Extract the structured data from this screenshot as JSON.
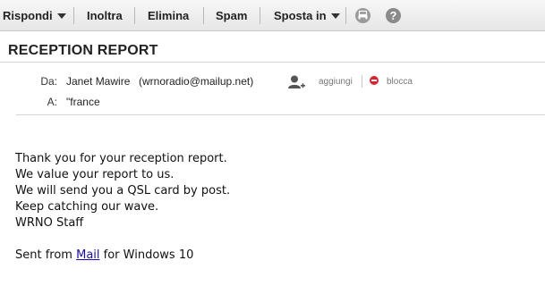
{
  "toolbar": {
    "reply_label": "Rispondi",
    "forward_label": "Inoltra",
    "delete_label": "Elimina",
    "spam_label": "Spam",
    "move_label": "Sposta in",
    "print_icon": "print-icon",
    "help_icon": "help-icon",
    "help_glyph": "?"
  },
  "message": {
    "subject": "RECEPTION REPORT",
    "from_label": "Da:",
    "from_name": "Janet Mawire",
    "from_email": "(wrnoradio@mailup.net)",
    "to_label": "A:",
    "to_value": "\"france",
    "add_contact_label": "aggiungi",
    "block_label": "blocca"
  },
  "body": {
    "lines": [
      "Thank you for your reception report.",
      "We value your report to us.",
      "We will send you a QSL card by post.",
      "Keep catching our wave.",
      "WRNO Staff"
    ],
    "signature_prefix": "Sent from ",
    "signature_link": "Mail",
    "signature_suffix": " for Windows 10"
  },
  "colors": {
    "block_icon": "#d9232e",
    "icon_gray": "#8a8a8a",
    "link": "#1a0dab"
  }
}
